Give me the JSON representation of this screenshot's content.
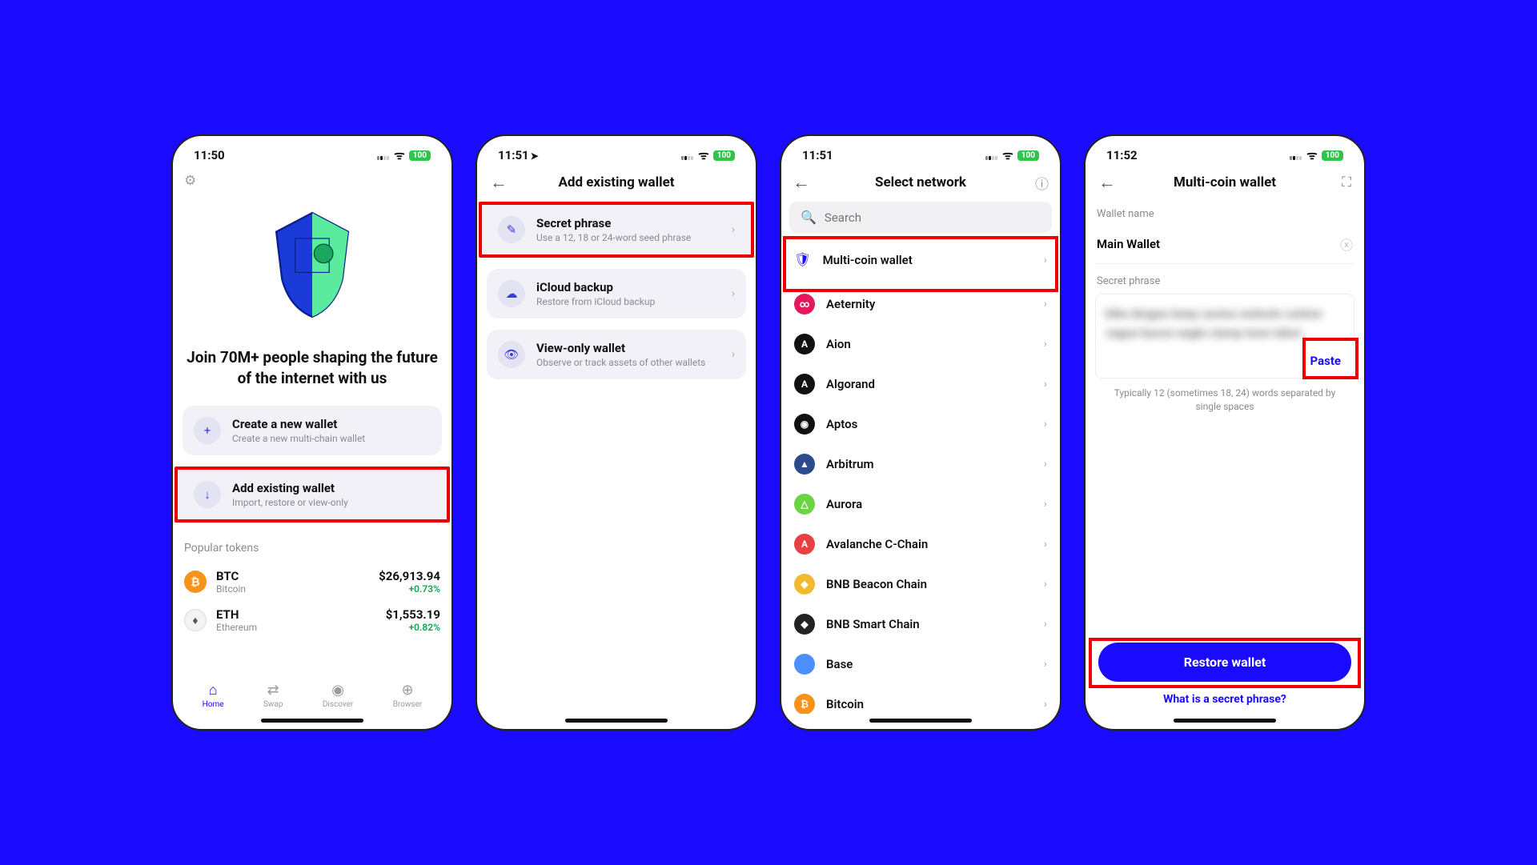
{
  "status": {
    "time1": "11:50",
    "time2": "11:51",
    "time3": "11:51",
    "time4": "11:52",
    "battery": "100"
  },
  "screen1": {
    "headline": "Join 70M+ people shaping the future of the internet with us",
    "create": {
      "title": "Create a new wallet",
      "sub": "Create a new multi-chain wallet"
    },
    "add": {
      "title": "Add existing wallet",
      "sub": "Import, restore or view-only"
    },
    "popular_label": "Popular tokens",
    "tokens": [
      {
        "sym": "BTC",
        "name": "Bitcoin",
        "price": "$26,913.94",
        "change": "+0.73%",
        "color": "#f7931a"
      },
      {
        "sym": "ETH",
        "name": "Ethereum",
        "price": "$1,553.19",
        "change": "+0.82%",
        "color": "#f3f3f3"
      }
    ],
    "tabs": [
      {
        "label": "Home",
        "icon": "⌂"
      },
      {
        "label": "Swap",
        "icon": "⇄"
      },
      {
        "label": "Discover",
        "icon": "●"
      },
      {
        "label": "Browser",
        "icon": "⊕"
      }
    ]
  },
  "screen2": {
    "title": "Add existing wallet",
    "options": [
      {
        "title": "Secret phrase",
        "sub": "Use a 12, 18 or 24-word seed phrase",
        "icon": "✎"
      },
      {
        "title": "iCloud backup",
        "sub": "Restore from iCloud backup",
        "icon": "☁"
      },
      {
        "title": "View-only wallet",
        "sub": "Observe or track assets of other wallets",
        "icon": "👁"
      }
    ]
  },
  "screen3": {
    "title": "Select network",
    "search_placeholder": "Search",
    "multi": "Multi-coin wallet",
    "networks": [
      {
        "name": "Aeternity",
        "color": "#e6185c",
        "letter": "∞"
      },
      {
        "name": "Aion",
        "color": "#111",
        "letter": "A"
      },
      {
        "name": "Algorand",
        "color": "#111",
        "letter": "A"
      },
      {
        "name": "Aptos",
        "color": "#111",
        "letter": "◉"
      },
      {
        "name": "Arbitrum",
        "color": "#2d4a8a",
        "letter": "▲"
      },
      {
        "name": "Aurora",
        "color": "#6cd444",
        "letter": "△"
      },
      {
        "name": "Avalanche C-Chain",
        "color": "#e84142",
        "letter": "A"
      },
      {
        "name": "BNB Beacon Chain",
        "color": "#f3ba2f",
        "letter": "◆"
      },
      {
        "name": "BNB Smart Chain",
        "color": "#222",
        "letter": "◆"
      },
      {
        "name": "Base",
        "color": "#4d8eff",
        "letter": ""
      },
      {
        "name": "Bitcoin",
        "color": "#f7931a",
        "letter": "₿"
      }
    ]
  },
  "screen4": {
    "title": "Multi-coin wallet",
    "wallet_name_label": "Wallet name",
    "wallet_name": "Main Wallet",
    "phrase_label": "Secret phrase",
    "phrase_blur": "bike dragon keep cactus walnuts carbon vague bacon eagle clamp town labor",
    "paste": "Paste",
    "hint": "Typically 12 (sometimes 18, 24) words separated by single spaces",
    "restore_btn": "Restore wallet",
    "link": "What is a secret phrase?"
  }
}
